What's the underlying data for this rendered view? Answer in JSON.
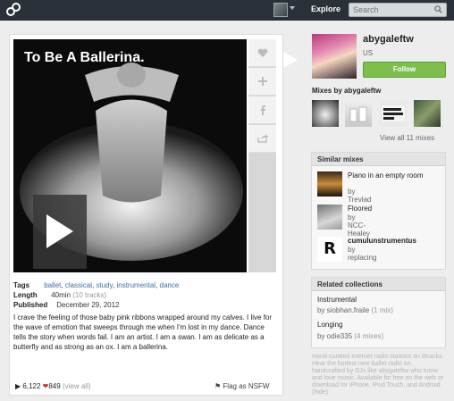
{
  "topbar": {
    "explore_label": "Explore",
    "search_placeholder": "Search"
  },
  "mix": {
    "cover_title": "To Be A Ballerina.",
    "tags_label": "Tags",
    "tags": [
      "ballet",
      "classical",
      "study",
      "instrumental",
      "dance"
    ],
    "length_label": "Length",
    "length_value": "40min",
    "length_tracks": "(10 tracks)",
    "published_label": "Published",
    "published_value": "December 29, 2012",
    "description": "I crave the feeling of those baby pink ribbons wrapped around my calves. I live for the wave of emotion that sweeps through me when I'm lost in my dance. Dance tells the story when words fail. I am an artist. I am a swan. I am as delicate as a butterfly and as strong as an ox. I am a ballerina.",
    "plays": "6,122",
    "likes": "849",
    "view_all_label": "(view all)",
    "flag_label": "Flag as NSFW"
  },
  "profile": {
    "username": "abygaleftw",
    "location": "US",
    "follow_label": "Follow",
    "mixes_heading": "Mixes by abygaleftw",
    "view_all_mixes": "View all 11 mixes"
  },
  "similar": {
    "heading": "Similar mixes",
    "items": [
      {
        "title": "Piano in an empty room",
        "by": "by Trevlad"
      },
      {
        "title": "Floored",
        "by": "by NCC-Healey"
      },
      {
        "title": "cumulunstrumentus",
        "by": "by replacing"
      }
    ]
  },
  "collections": {
    "heading": "Related collections",
    "items": [
      {
        "title": "Instrumental",
        "by": "by siobhan.fraile",
        "count": "(1 mix)"
      },
      {
        "title": "Longing",
        "by": "by odie335",
        "count": "(4 mixes)"
      }
    ]
  },
  "promo_text": "Hand-curated internet radio stations on 8tracks. Hear the hottest new ballet radio on, handcrafted by DJs like abygaleftw who know and love music. Available for free on the web or download for iPhone, iPod Touch, and Android. (hide)"
}
